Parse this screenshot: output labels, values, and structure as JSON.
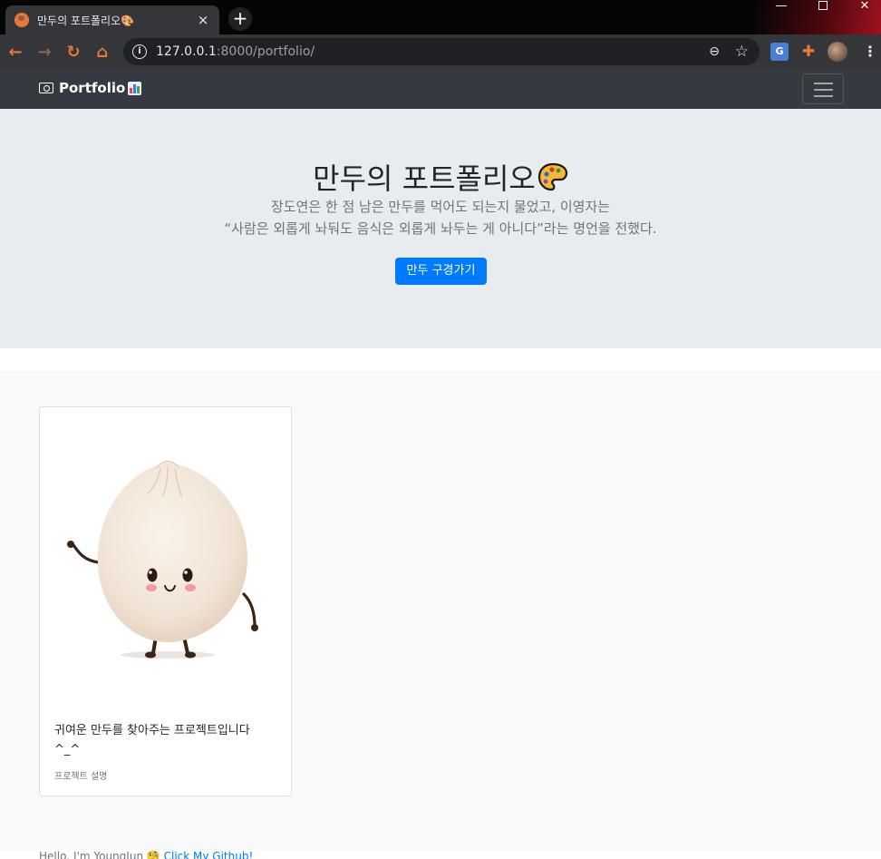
{
  "browser": {
    "tab_title": "만두의 포트폴리오🎨",
    "tab_close": "×",
    "new_tab": "+",
    "url_host": "127.0.0.1",
    "url_path": ":8000/portfolio/",
    "minimize": "—",
    "close": "✕",
    "back": "←",
    "forward": "→",
    "reload": "↻",
    "home": "⌂",
    "info": "i",
    "zoom": "⊖",
    "star": "☆",
    "translate": "G",
    "extensions": "✚",
    "menu": "⋮"
  },
  "navbar": {
    "brand": "Portfolio"
  },
  "hero": {
    "title": "만두의 포트폴리오",
    "lead_line1": "장도연은 한 점 남은 만두를 먹어도 되는지 물었고, 이영자는",
    "lead_line2": "“사람은 외롭게 놔둬도 음식은 외롭게 놔두는 게 아니다”라는 명언을 전했다.",
    "button": "만두 구경가기"
  },
  "card": {
    "text": "귀여운 만두를 찾아주는 프로젝트입니다 ^_^",
    "subtext": "프로젝트 설명"
  },
  "footer": {
    "text": "Hello, I'm YoungJun 🧐 ",
    "link": "Click My Github!"
  },
  "colors": {
    "navbar": "#343a40",
    "jumbotron": "#e9ecef",
    "primary": "#007bff",
    "album": "#f8f9fa"
  }
}
